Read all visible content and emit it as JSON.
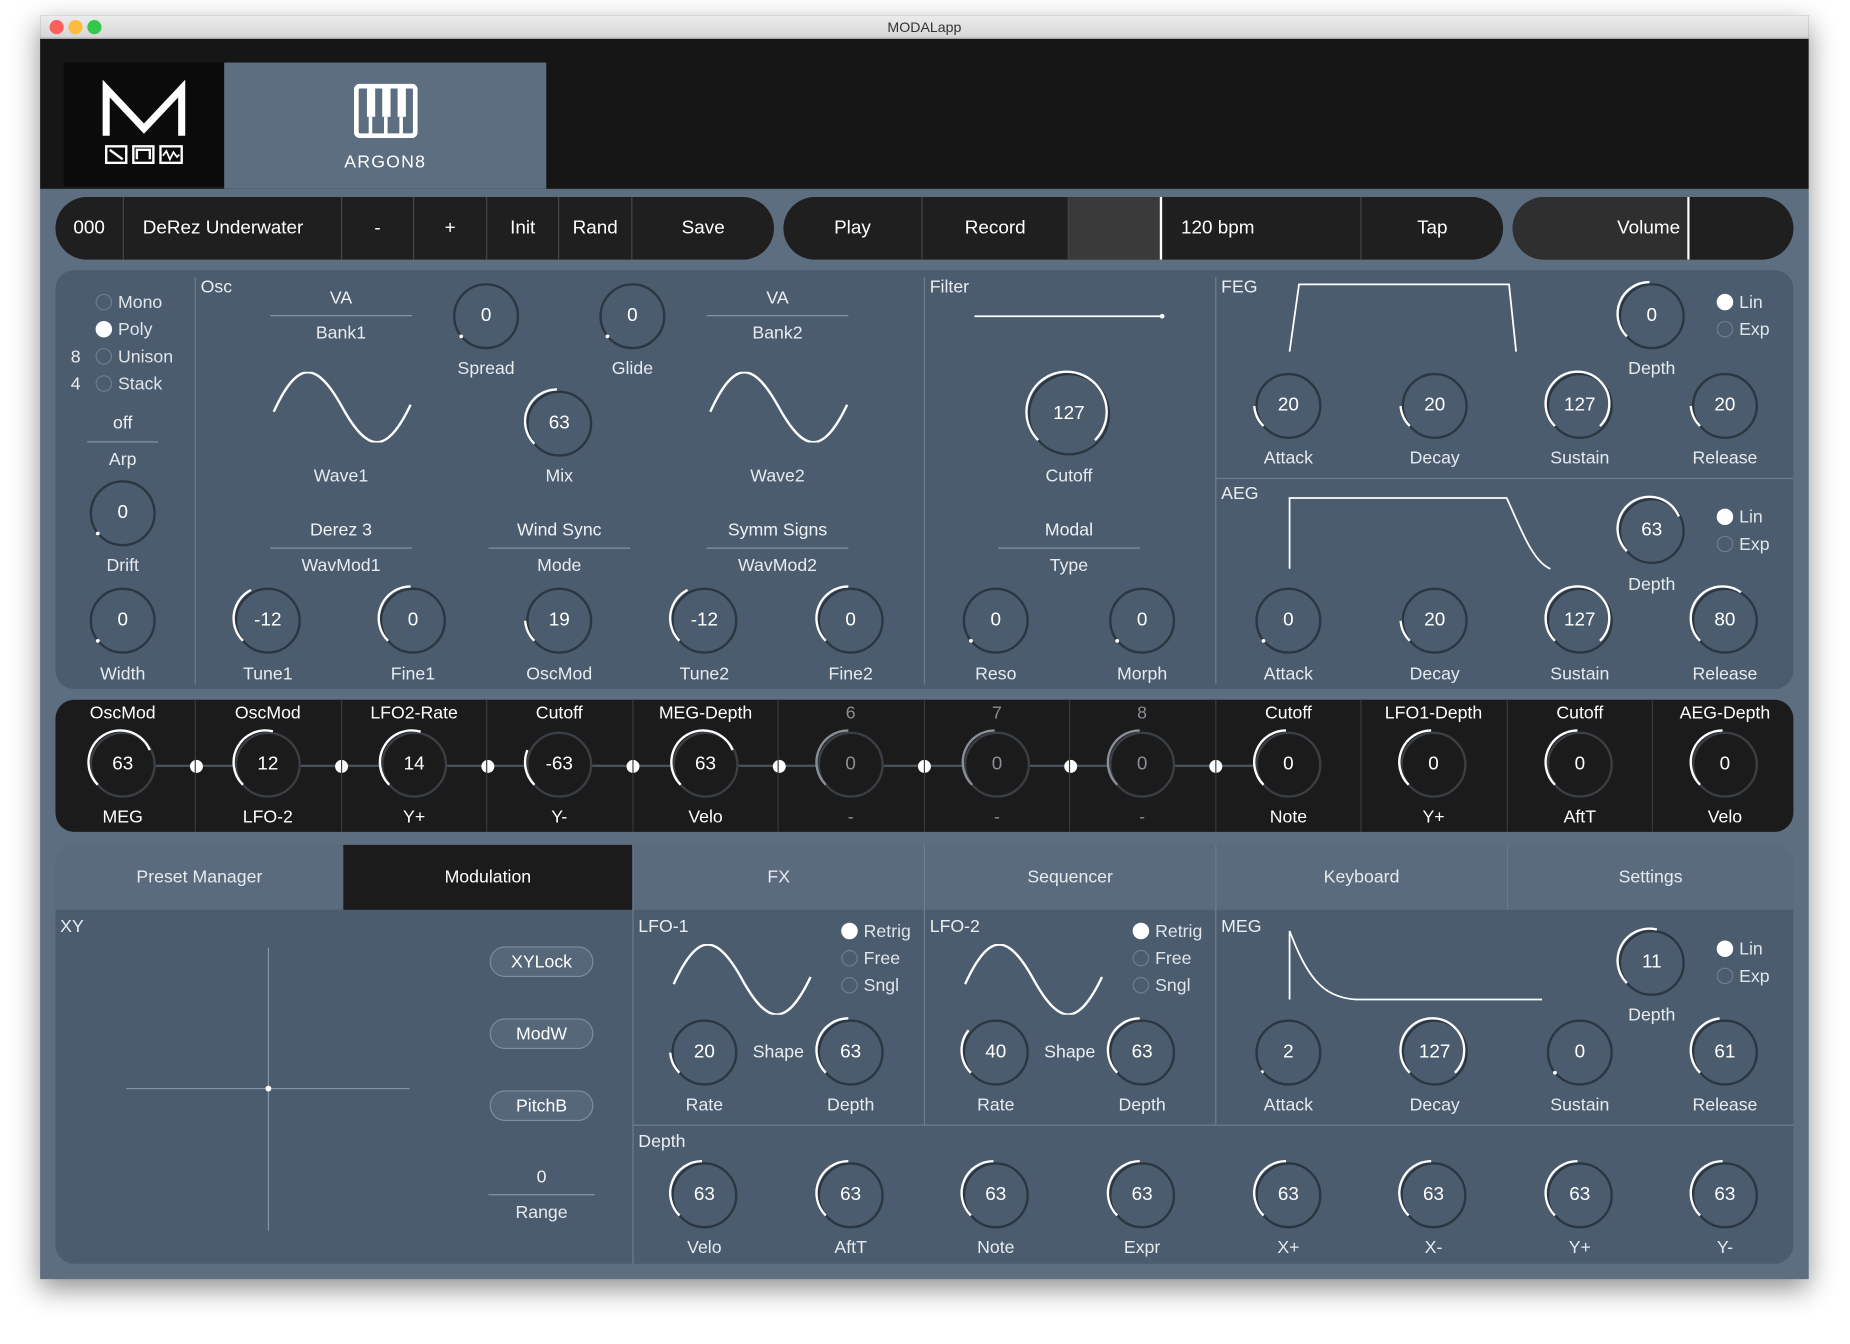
{
  "window": {
    "title": "MODALapp"
  },
  "header": {
    "brand_logo": "M",
    "synth_name": "ARGON8"
  },
  "preset_bar": {
    "number": "000",
    "name": "DeRez Underwater",
    "minus": "-",
    "plus": "+",
    "init": "Init",
    "rand": "Rand",
    "save": "Save"
  },
  "transport": {
    "play": "Play",
    "record": "Record",
    "tempo": "120 bpm",
    "tap": "Tap"
  },
  "volume": {
    "label": "Volume"
  },
  "voice": {
    "modes": [
      "Mono",
      "Poly",
      "Unison",
      "Stack"
    ],
    "selected": "Poly",
    "unison_count": "8",
    "stack_count": "4",
    "arp_value": "off",
    "arp_label": "Arp",
    "drift": {
      "value": "0",
      "label": "Drift"
    },
    "width": {
      "value": "0",
      "label": "Width"
    }
  },
  "osc": {
    "title": "Osc",
    "bank1_value": "VA",
    "bank1_label": "Bank1",
    "bank2_value": "VA",
    "bank2_label": "Bank2",
    "wave1_label": "Wave1",
    "wave2_label": "Wave2",
    "spread": {
      "value": "0",
      "label": "Spread"
    },
    "glide": {
      "value": "0",
      "label": "Glide"
    },
    "mix": {
      "value": "63",
      "label": "Mix"
    },
    "wavmod1_value": "Derez 3",
    "wavmod1_label": "WavMod1",
    "mode_value": "Wind Sync",
    "mode_label": "Mode",
    "wavmod2_value": "Symm Signs",
    "wavmod2_label": "WavMod2",
    "tune1": {
      "value": "-12",
      "label": "Tune1"
    },
    "fine1": {
      "value": "0",
      "label": "Fine1"
    },
    "oscmod": {
      "value": "19",
      "label": "OscMod"
    },
    "tune2": {
      "value": "-12",
      "label": "Tune2"
    },
    "fine2": {
      "value": "0",
      "label": "Fine2"
    }
  },
  "filter": {
    "title": "Filter",
    "cutoff": {
      "value": "127",
      "label": "Cutoff"
    },
    "type_value": "Modal",
    "type_label": "Type",
    "reso": {
      "value": "0",
      "label": "Reso"
    },
    "morph": {
      "value": "0",
      "label": "Morph"
    }
  },
  "feg": {
    "title": "FEG",
    "depth": {
      "value": "0",
      "label": "Depth"
    },
    "curve": [
      "Lin",
      "Exp"
    ],
    "curve_selected": "Lin",
    "attack": {
      "value": "20",
      "label": "Attack"
    },
    "decay": {
      "value": "20",
      "label": "Decay"
    },
    "sustain": {
      "value": "127",
      "label": "Sustain"
    },
    "release": {
      "value": "20",
      "label": "Release"
    }
  },
  "aeg": {
    "title": "AEG",
    "depth": {
      "value": "63",
      "label": "Depth"
    },
    "curve": [
      "Lin",
      "Exp"
    ],
    "curve_selected": "Lin",
    "attack": {
      "value": "0",
      "label": "Attack"
    },
    "decay": {
      "value": "20",
      "label": "Decay"
    },
    "sustain": {
      "value": "127",
      "label": "Sustain"
    },
    "release": {
      "value": "80",
      "label": "Release"
    }
  },
  "mod_matrix": [
    {
      "dest": "OscMod",
      "value": "63",
      "source": "MEG",
      "norm": 0.75
    },
    {
      "dest": "OscMod",
      "value": "12",
      "source": "LFO-2",
      "norm": 0.55
    },
    {
      "dest": "LFO2-Rate",
      "value": "14",
      "source": "Y+",
      "norm": 0.56
    },
    {
      "dest": "Cutoff",
      "value": "-63",
      "source": "Y-",
      "norm": 0.25
    },
    {
      "dest": "MEG-Depth",
      "value": "63",
      "source": "Velo",
      "norm": 0.75
    },
    {
      "dest": "6",
      "value": "0",
      "source": "-",
      "norm": 0.5
    },
    {
      "dest": "7",
      "value": "0",
      "source": "-",
      "norm": 0.5
    },
    {
      "dest": "8",
      "value": "0",
      "source": "-",
      "norm": 0.5
    },
    {
      "dest": "Cutoff",
      "value": "0",
      "source": "Note",
      "norm": 0.5
    },
    {
      "dest": "LFO1-Depth",
      "value": "0",
      "source": "Y+",
      "norm": 0.5
    },
    {
      "dest": "Cutoff",
      "value": "0",
      "source": "AftT",
      "norm": 0.5
    },
    {
      "dest": "AEG-Depth",
      "value": "0",
      "source": "Velo",
      "norm": 0.5
    }
  ],
  "tabs": [
    "Preset Manager",
    "Modulation",
    "FX",
    "Sequencer",
    "Keyboard",
    "Settings"
  ],
  "active_tab": "Modulation",
  "xy": {
    "title": "XY",
    "xylock": "XYLock",
    "modw": "ModW",
    "pitchb": "PitchB",
    "range_value": "0",
    "range_label": "Range"
  },
  "lfo1": {
    "title": "LFO-1",
    "modes": [
      "Retrig",
      "Free",
      "Sngl"
    ],
    "selected": "Retrig",
    "rate": {
      "value": "20",
      "label": "Rate"
    },
    "shape_label": "Shape",
    "depth": {
      "value": "63",
      "label": "Depth"
    }
  },
  "lfo2": {
    "title": "LFO-2",
    "modes": [
      "Retrig",
      "Free",
      "Sngl"
    ],
    "selected": "Retrig",
    "rate": {
      "value": "40",
      "label": "Rate"
    },
    "shape_label": "Shape",
    "depth": {
      "value": "63",
      "label": "Depth"
    }
  },
  "meg": {
    "title": "MEG",
    "depth": {
      "value": "11",
      "label": "Depth"
    },
    "curve": [
      "Lin",
      "Exp"
    ],
    "curve_selected": "Lin",
    "attack": {
      "value": "2",
      "label": "Attack"
    },
    "decay": {
      "value": "127",
      "label": "Decay"
    },
    "sustain": {
      "value": "0",
      "label": "Sustain"
    },
    "release": {
      "value": "61",
      "label": "Release"
    }
  },
  "depth_row": {
    "title": "Depth",
    "items": [
      {
        "value": "63",
        "label": "Velo"
      },
      {
        "value": "63",
        "label": "AftT"
      },
      {
        "value": "63",
        "label": "Note"
      },
      {
        "value": "63",
        "label": "Expr"
      },
      {
        "value": "63",
        "label": "X+"
      },
      {
        "value": "63",
        "label": "X-"
      },
      {
        "value": "63",
        "label": "Y+"
      },
      {
        "value": "63",
        "label": "Y-"
      }
    ]
  },
  "colors": {
    "panel": "#4b5c6e",
    "frame": "#5c6e80",
    "dark": "#1b1b1b",
    "knob_ring": "#2b3641",
    "indicator": "#ffffff"
  }
}
